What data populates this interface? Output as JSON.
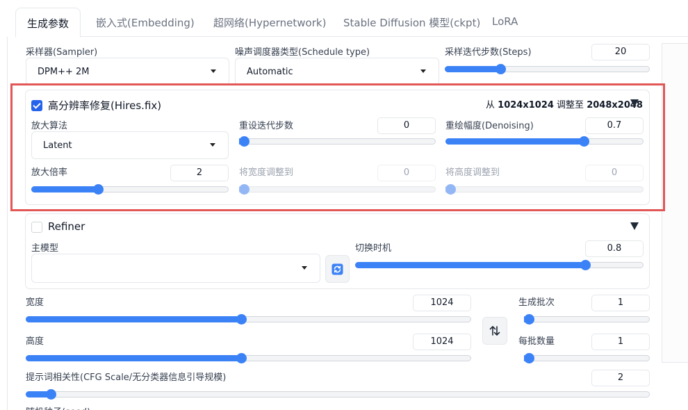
{
  "tabs": [
    {
      "label": "生成参数"
    },
    {
      "label": "嵌入式(Embedding)"
    },
    {
      "label": "超网络(Hypernetwork)"
    },
    {
      "label": "Stable Diffusion 模型(ckpt)"
    },
    {
      "label": "LoRA"
    }
  ],
  "sampler": {
    "label": "采样器(Sampler)",
    "value": "DPM++ 2M"
  },
  "schedule": {
    "label": "噪声调度器类型(Schedule type)",
    "value": "Automatic"
  },
  "steps": {
    "label": "采样迭代步数(Steps)",
    "value": "20",
    "fraction": 0.27
  },
  "hires": {
    "title": "高分辨率修复(Hires.fix)",
    "checked": true,
    "res_prefix": "从",
    "res_from": "1024x1024",
    "res_mid": "调整至",
    "res_to": "2048x2048",
    "upscaler": {
      "label": "放大算法",
      "value": "Latent"
    },
    "steps": {
      "label": "重设迭代步数",
      "value": "0",
      "fraction": 0.0
    },
    "denoise": {
      "label": "重绘幅度(Denoising)",
      "value": "0.7",
      "fraction": 0.7
    },
    "scale": {
      "label": "放大倍率",
      "value": "2",
      "fraction": 0.34
    },
    "resize_w": {
      "label": "将宽度调整到",
      "value": "0",
      "fraction": 0.0
    },
    "resize_h": {
      "label": "将高度调整到",
      "value": "0",
      "fraction": 0.0
    }
  },
  "refiner": {
    "title": "Refiner",
    "checked": false,
    "model": {
      "label": "主模型",
      "value": ""
    },
    "switch": {
      "label": "切换时机",
      "value": "0.8",
      "fraction": 0.8
    }
  },
  "width": {
    "label": "宽度",
    "value": "1024",
    "fraction": 0.485
  },
  "height": {
    "label": "高度",
    "value": "1024",
    "fraction": 0.485
  },
  "batch_count": {
    "label": "生成批次",
    "value": "1",
    "fraction": 0.0
  },
  "batch_size": {
    "label": "每批数量",
    "value": "1",
    "fraction": 0.0
  },
  "cfg": {
    "label": "提示词相关性(CFG Scale/无分类器信息引导规模)",
    "value": "2",
    "fraction": 0.04
  },
  "seed": {
    "label": "随机种子(seed)"
  },
  "icons": {
    "refresh": "refresh-icon",
    "swap": "swap-dimensions-icon",
    "dropdown": "chevron-down-icon",
    "collapse": "triangle-down-icon"
  },
  "colors": {
    "accent": "#3b82f6",
    "highlight_box": "#e25656",
    "check": "#2563eb"
  }
}
